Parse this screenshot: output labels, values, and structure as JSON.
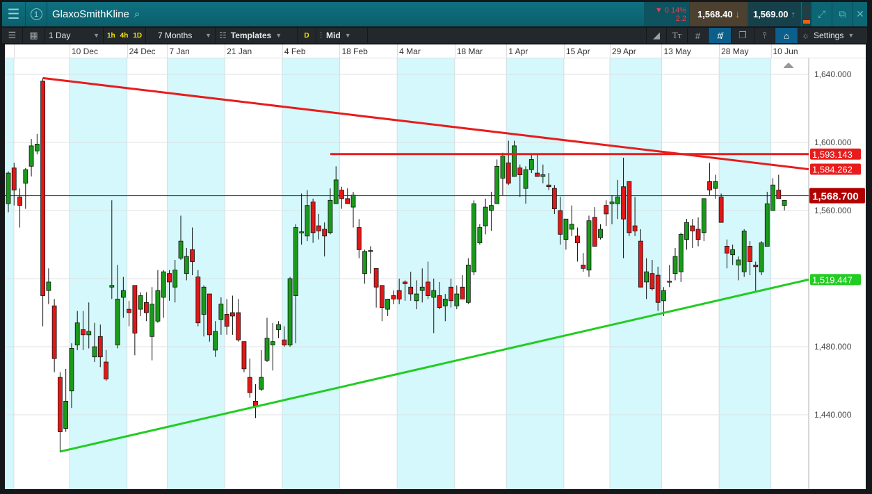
{
  "header": {
    "menu_icon": "hamburger-icon",
    "watchlist_number": "1",
    "instrument": "GlaxoSmithKline",
    "change_pct": "▼ 0.14%",
    "change_abs": "2.2",
    "sell_price": "1,568.40",
    "buy_price": "1,569.00",
    "sell_arrow": "↓",
    "buy_arrow": "↑",
    "level_bars": 1
  },
  "toolbar": {
    "interval": "1 Day",
    "quick_intervals": [
      "1h",
      "4h",
      "1D"
    ],
    "range": "7 Months",
    "templates": "Templates",
    "d_label": "D",
    "price_type": "Mid",
    "settings": "Settings"
  },
  "chart_data": {
    "type": "candlestick",
    "instrument": "GlaxoSmithKline",
    "ylim": [
      1396.7,
      1643.7
    ],
    "yticks": [
      1640,
      1600,
      1560,
      1520,
      1480,
      1440
    ],
    "ytick_labels": [
      "1,640.000",
      "1,600.000",
      "1,560.000",
      "1,520.000",
      "1,480.000",
      "1,440.000"
    ],
    "date_ticks": [
      {
        "label": "",
        "index": -1
      },
      {
        "label": "10 Dec",
        "index": 11
      },
      {
        "label": "24 Dec",
        "index": 21
      },
      {
        "label": "7 Jan",
        "index": 28
      },
      {
        "label": "21 Jan",
        "index": 38
      },
      {
        "label": "4 Feb",
        "index": 48
      },
      {
        "label": "18 Feb",
        "index": 58
      },
      {
        "label": "4 Mar",
        "index": 68
      },
      {
        "label": "18 Mar",
        "index": 78
      },
      {
        "label": "1 Apr",
        "index": 87
      },
      {
        "label": "15 Apr",
        "index": 97
      },
      {
        "label": "29 Apr",
        "index": 105
      },
      {
        "label": "13 May",
        "index": 114
      },
      {
        "label": "28 May",
        "index": 124
      },
      {
        "label": "10 Jun",
        "index": 133
      }
    ],
    "candles_ohlc": [
      [
        1564,
        1583,
        1559,
        1582
      ],
      [
        1585,
        1588,
        1563,
        1572
      ],
      [
        1568,
        1573,
        1550,
        1563
      ],
      [
        1576,
        1585,
        1561,
        1584
      ],
      [
        1586,
        1602,
        1580,
        1598
      ],
      [
        1595,
        1605,
        1593,
        1599
      ],
      [
        1636,
        1638,
        1492,
        1510
      ],
      [
        1513,
        1526,
        1505,
        1518
      ],
      [
        1504,
        1508,
        1465,
        1473
      ],
      [
        1462,
        1465,
        1418,
        1430
      ],
      [
        1432,
        1467,
        1430,
        1448
      ],
      [
        1454,
        1482,
        1444,
        1479
      ],
      [
        1481,
        1501,
        1478,
        1494
      ],
      [
        1490,
        1501,
        1478,
        1487
      ],
      [
        1487,
        1506,
        1479,
        1489
      ],
      [
        1474,
        1494,
        1471,
        1480
      ],
      [
        1486,
        1493,
        1468,
        1474
      ],
      [
        1471,
        1478,
        1460,
        1461
      ],
      [
        1515,
        1566,
        1508,
        1516
      ],
      [
        1481,
        1528,
        1479,
        1508
      ],
      [
        1509,
        1521,
        1497,
        1513
      ],
      [
        1502,
        1507,
        1492,
        1500
      ],
      [
        1516,
        1516,
        1475,
        1488
      ],
      [
        1502,
        1512,
        1498,
        1510
      ],
      [
        1506,
        1512,
        1495,
        1500
      ],
      [
        1486,
        1515,
        1472,
        1505
      ],
      [
        1495,
        1525,
        1494,
        1513
      ],
      [
        1509,
        1525,
        1497,
        1524
      ],
      [
        1523,
        1525,
        1507,
        1518
      ],
      [
        1515,
        1531,
        1506,
        1525
      ],
      [
        1532,
        1557,
        1531,
        1542
      ],
      [
        1523,
        1538,
        1519,
        1533
      ],
      [
        1537,
        1550,
        1522,
        1530
      ],
      [
        1521,
        1525,
        1492,
        1494
      ],
      [
        1499,
        1516,
        1486,
        1515
      ],
      [
        1511,
        1511,
        1483,
        1487
      ],
      [
        1478,
        1495,
        1474,
        1489
      ],
      [
        1496,
        1509,
        1487,
        1505
      ],
      [
        1499,
        1508,
        1487,
        1492
      ],
      [
        1500,
        1510,
        1487,
        1498
      ],
      [
        1500,
        1508,
        1483,
        1484
      ],
      [
        1483,
        1483,
        1465,
        1467
      ],
      [
        1462,
        1473,
        1450,
        1453
      ],
      [
        1448,
        1458,
        1438,
        1445
      ],
      [
        1455,
        1478,
        1454,
        1462
      ],
      [
        1472,
        1497,
        1471,
        1485
      ],
      [
        1481,
        1494,
        1466,
        1483
      ],
      [
        1490,
        1495,
        1485,
        1493
      ],
      [
        1484,
        1492,
        1480,
        1481
      ],
      [
        1481,
        1521,
        1480,
        1520
      ],
      [
        1510,
        1552,
        1482,
        1550
      ],
      [
        1547,
        1570,
        1540,
        1547.5
      ],
      [
        1545,
        1572,
        1542,
        1563
      ],
      [
        1565,
        1567,
        1541,
        1547
      ],
      [
        1551,
        1558,
        1543,
        1548
      ],
      [
        1549,
        1553,
        1533,
        1545
      ],
      [
        1547,
        1573,
        1546,
        1566
      ],
      [
        1564,
        1586,
        1564,
        1578
      ],
      [
        1572,
        1574,
        1561,
        1567
      ],
      [
        1567,
        1573,
        1564,
        1564
      ],
      [
        1562,
        1571,
        1550,
        1569
      ],
      [
        1550,
        1555,
        1532,
        1537
      ],
      [
        1523,
        1537,
        1517,
        1536
      ],
      [
        1536,
        1539,
        1523,
        1536.5
      ],
      [
        1526,
        1526,
        1503,
        1515
      ],
      [
        1516,
        1516,
        1495,
        1503
      ],
      [
        1502,
        1508,
        1498,
        1508
      ],
      [
        1510,
        1513,
        1505,
        1508
      ],
      [
        1513,
        1520,
        1505,
        1508
      ],
      [
        1518,
        1519,
        1507,
        1517
      ],
      [
        1515,
        1524,
        1507,
        1511
      ],
      [
        1507,
        1519,
        1502,
        1511
      ],
      [
        1513,
        1526,
        1506,
        1515
      ],
      [
        1518,
        1530,
        1508,
        1510
      ],
      [
        1509,
        1520,
        1488,
        1513
      ],
      [
        1510,
        1518,
        1502,
        1503
      ],
      [
        1504,
        1511,
        1495,
        1508
      ],
      [
        1515,
        1520,
        1503,
        1507
      ],
      [
        1504,
        1516,
        1502,
        1511
      ],
      [
        1515,
        1522,
        1508,
        1508
      ],
      [
        1506,
        1532,
        1505,
        1528
      ],
      [
        1524,
        1566,
        1522,
        1564
      ],
      [
        1541,
        1552,
        1540,
        1550
      ],
      [
        1551,
        1567,
        1546,
        1562
      ],
      [
        1560,
        1571,
        1548,
        1563
      ],
      [
        1564,
        1590,
        1564,
        1586
      ],
      [
        1579,
        1594,
        1569,
        1592
      ],
      [
        1588,
        1601,
        1575,
        1576
      ],
      [
        1580,
        1601,
        1580,
        1598
      ],
      [
        1585,
        1587,
        1568,
        1581
      ],
      [
        1573,
        1586,
        1564,
        1584
      ],
      [
        1584,
        1593,
        1582,
        1590
      ],
      [
        1582,
        1593,
        1580,
        1580
      ],
      [
        1580,
        1587,
        1576,
        1581
      ],
      [
        1575,
        1582,
        1572,
        1574
      ],
      [
        1573,
        1575,
        1558,
        1561
      ],
      [
        1560,
        1568,
        1540,
        1546
      ],
      [
        1543,
        1555,
        1537,
        1555
      ],
      [
        1549,
        1563,
        1545,
        1552
      ],
      [
        1545,
        1550,
        1530,
        1541
      ],
      [
        1528,
        1535,
        1524,
        1526
      ],
      [
        1525,
        1557,
        1521,
        1554
      ],
      [
        1556,
        1562,
        1539,
        1539
      ],
      [
        1544,
        1552,
        1543,
        1549
      ],
      [
        1563,
        1566,
        1551,
        1558
      ],
      [
        1564,
        1569,
        1552,
        1565
      ],
      [
        1564,
        1578,
        1555,
        1568
      ],
      [
        1574,
        1591,
        1532,
        1555
      ],
      [
        1577,
        1577,
        1545,
        1547
      ],
      [
        1551,
        1568,
        1545,
        1548
      ],
      [
        1542,
        1549,
        1515,
        1515
      ],
      [
        1518,
        1532,
        1508,
        1524
      ],
      [
        1523,
        1531,
        1513,
        1514
      ],
      [
        1522,
        1527,
        1501,
        1506
      ],
      [
        1507,
        1515,
        1498,
        1513
      ],
      [
        1518,
        1528,
        1515,
        1518.5
      ],
      [
        1523,
        1538,
        1519,
        1533
      ],
      [
        1524,
        1547,
        1518,
        1546
      ],
      [
        1543,
        1555,
        1537,
        1553
      ],
      [
        1551,
        1555,
        1538,
        1548
      ],
      [
        1549,
        1556,
        1539,
        1543
      ],
      [
        1547,
        1567,
        1542,
        1567
      ],
      [
        1577,
        1588,
        1569,
        1572
      ],
      [
        1573,
        1581,
        1567,
        1577
      ],
      [
        1568,
        1570,
        1553,
        1553
      ],
      [
        1539,
        1543,
        1526,
        1535
      ],
      [
        1534,
        1540,
        1528,
        1537
      ],
      [
        1528,
        1533,
        1519,
        1531
      ],
      [
        1524,
        1549,
        1521,
        1548
      ],
      [
        1539,
        1542,
        1522,
        1530
      ],
      [
        1528,
        1530,
        1512,
        1527
      ],
      [
        1524,
        1542,
        1522,
        1541
      ],
      [
        1539,
        1571,
        1539,
        1564
      ],
      [
        1560,
        1579,
        1560,
        1575
      ],
      [
        1572,
        1581,
        1567,
        1567
      ],
      [
        1563,
        1566,
        1560,
        1566
      ]
    ],
    "trendlines": [
      {
        "name": "resistance-trendline",
        "color": "#e81c1c",
        "from": {
          "index": 6,
          "price": 1637.8
        },
        "to": {
          "index": "edge",
          "price": 1584.262
        },
        "tag": "1,584.262"
      },
      {
        "name": "horizontal-resistance-line",
        "color": "#e81c1c",
        "from": {
          "index": 56,
          "price": 1593.143
        },
        "to": {
          "index": "edge",
          "price": 1593.143
        },
        "tag": "1,593.143"
      },
      {
        "name": "support-trendline",
        "color": "#22cc22",
        "from": {
          "index": 9,
          "price": 1418.4
        },
        "to": {
          "index": "edge",
          "price": 1519.447
        },
        "tag": "1,519.447"
      }
    ],
    "current_price": 1568.7,
    "current_price_tag": "1,568.700",
    "colors": {
      "up": "#1a9a1a",
      "down": "#e01818",
      "band": "#d4f8fb",
      "current": "#b00000"
    }
  }
}
